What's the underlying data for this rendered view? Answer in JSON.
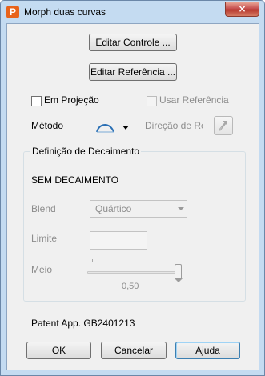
{
  "window": {
    "title": "Morph duas curvas",
    "app_icon": "P",
    "close_glyph": "×"
  },
  "buttons": {
    "edit_control": "Editar Controle ...",
    "edit_reference": "Editar Referência ..."
  },
  "options": {
    "projection_label": "Em Projeção",
    "projection_checked": false,
    "use_reference_label": "Usar Referência",
    "use_reference_checked": false,
    "use_reference_enabled": false
  },
  "method": {
    "label": "Método",
    "selected_icon": "arc-curve-icon",
    "direction_label": "Direção de Ré"
  },
  "decay": {
    "group_title": "Definição de Decaimento",
    "status_text": "SEM DECAIMENTO",
    "blend_label": "Blend",
    "blend_value": "Quártico",
    "limit_label": "Limite",
    "limit_value": "",
    "middle_label": "Meio",
    "middle_value_text": "0,50",
    "middle_value": 0.5
  },
  "footer": {
    "patent_text": "Patent App. GB2401213",
    "ok_label": "OK",
    "cancel_label": "Cancelar",
    "help_label": "Ajuda"
  },
  "colors": {
    "accent": "#3c7fb1",
    "app_icon": "#e8631b",
    "close_button": "#c75050",
    "method_icon": "#2a6fb4",
    "disabled_text": "#8d8d8d"
  }
}
